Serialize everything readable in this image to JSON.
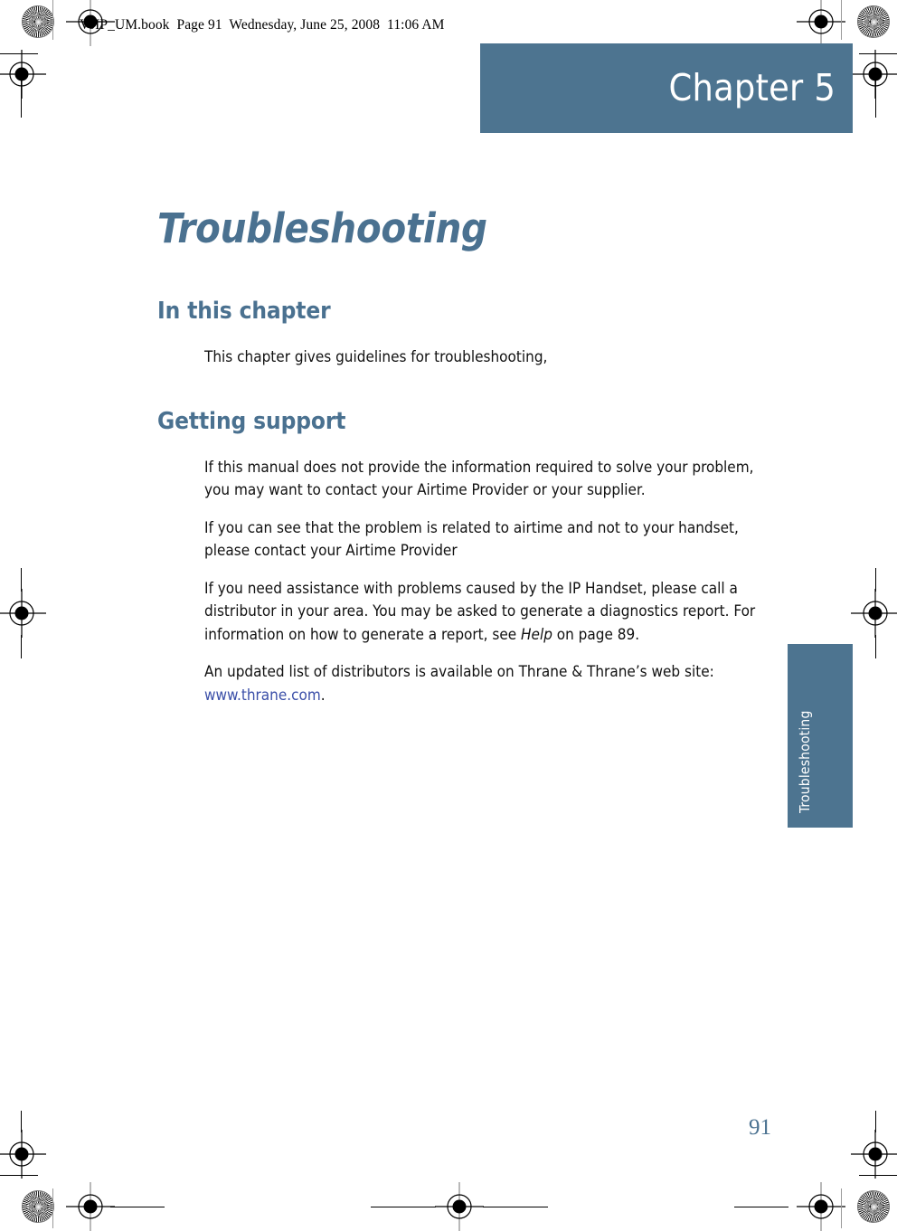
{
  "print_header": "VoIP_UM.book  Page 91  Wednesday, June 25, 2008  11:06 AM",
  "banner": {
    "label": "Chapter 5",
    "color": "#4d7490"
  },
  "page_title": "Troubleshooting",
  "sections": [
    {
      "heading": "In this chapter",
      "paragraphs": [
        "This chapter gives guidelines for troubleshooting,"
      ]
    },
    {
      "heading": "Getting support",
      "paragraphs": [
        "If this manual does not provide the information required to solve your problem, you may want to contact your Airtime Provider or your supplier.",
        "If you can see that the problem is related to airtime and not to your handset, please contact your Airtime Provider"
      ],
      "paragraph_with_italic": {
        "before": "If you need assistance with problems caused by the IP Handset, please call a distributor in your area. You may be asked to generate a diagnostics report. For information on how to generate a report, see ",
        "italic": "Help",
        "after": " on page 89."
      },
      "paragraph_with_link": {
        "before": "An updated list of distributors is available on Thrane & Thrane’s web site: ",
        "link": "www.thrane.com",
        "after": "."
      }
    }
  ],
  "side_tab": {
    "label": "Troubleshooting",
    "color": "#4d7490"
  },
  "page_number": "91",
  "colors": {
    "accent": "#4a7190",
    "banner": "#4d7490",
    "link": "#3b4fa8",
    "body_text": "#111111"
  }
}
